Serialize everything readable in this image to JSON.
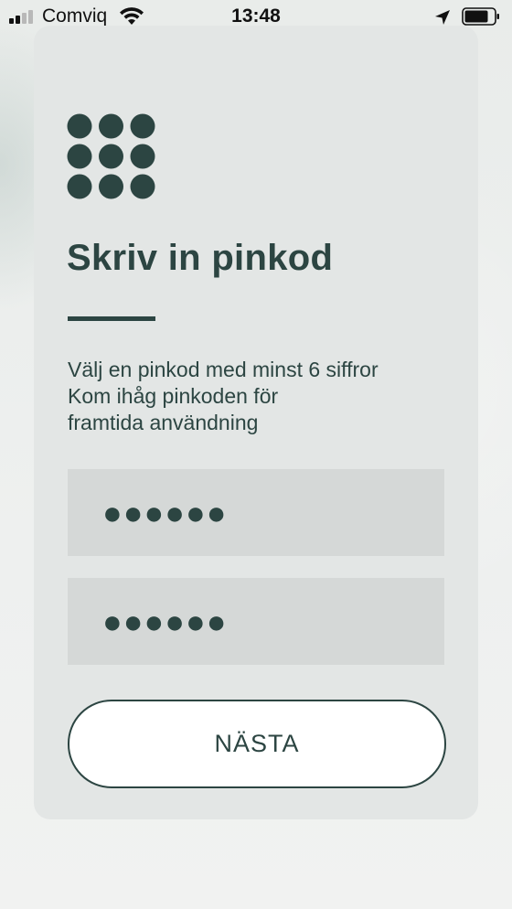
{
  "status_bar": {
    "carrier": "Comviq",
    "time": "13:48",
    "signal_bars_filled": 2,
    "icons": [
      "cellular-signal-icon",
      "wifi-icon",
      "location-arrow-icon",
      "battery-icon"
    ]
  },
  "pin_screen": {
    "logo_icon": "keypad-dots-icon",
    "title": "Skriv in pinkod",
    "instructions": [
      "Välj en pinkod med minst 6 siffror",
      "Kom ihåg pinkoden för",
      "framtida användning"
    ],
    "pin_field": {
      "value_masked": "●●●●●●"
    },
    "confirm_pin_field": {
      "value_masked": "●●●●●●"
    },
    "next_button_label": "NÄSTA"
  },
  "colors": {
    "accent": "#2c4542",
    "card_background": "#e3e6e5",
    "field_background": "#d5d8d7",
    "button_background": "#ffffff"
  }
}
